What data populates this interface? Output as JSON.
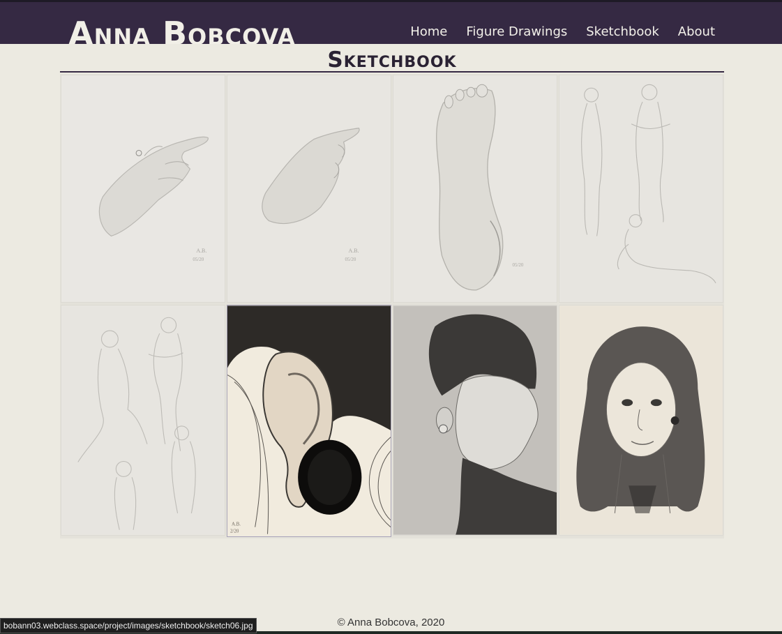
{
  "site": {
    "brand": "Anna Bobcova"
  },
  "nav": {
    "items": [
      {
        "label": "Home"
      },
      {
        "label": "Figure Drawings"
      },
      {
        "label": "Sketchbook"
      },
      {
        "label": "About"
      }
    ]
  },
  "page": {
    "title": "Sketchbook"
  },
  "gallery": {
    "items": [
      {
        "subject": "hand-with-ring"
      },
      {
        "subject": "pointing-hand"
      },
      {
        "subject": "foot"
      },
      {
        "subject": "figure-studies"
      },
      {
        "subject": "figure-studies"
      },
      {
        "subject": "ear-with-plug"
      },
      {
        "subject": "profile-portrait"
      },
      {
        "subject": "woman-portrait"
      }
    ]
  },
  "footer": {
    "copyright": "© Anna Bobcova, 2020"
  },
  "status_bar": {
    "url": "bobann03.webclass.space/project/images/sketchbook/sketch06.jpg"
  },
  "colors": {
    "header_bg": "#352943",
    "page_bg": "#eceae1",
    "text_dark": "#2a2233"
  }
}
